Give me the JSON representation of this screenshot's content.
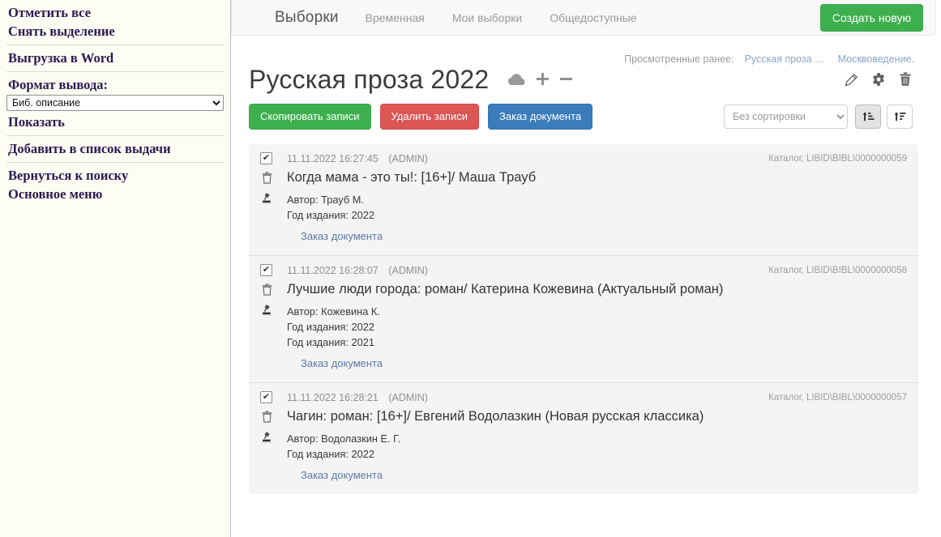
{
  "sidebar": {
    "groups": [
      {
        "items": [
          {
            "label": "Отметить все",
            "name": "select-all-link"
          },
          {
            "label": "Снять выделение",
            "name": "deselect-all-link"
          }
        ]
      },
      {
        "items": [
          {
            "label": "Выгрузка в Word",
            "name": "export-word-link"
          }
        ]
      },
      {
        "items": [
          {
            "label": "Формат вывода:",
            "name": "output-format-label",
            "type": "label"
          },
          {
            "label": "Биб. описание",
            "name": "output-format-select",
            "type": "select",
            "options": [
              "Биб. описание"
            ]
          },
          {
            "label": "Показать",
            "name": "show-link"
          }
        ]
      },
      {
        "items": [
          {
            "label": "Добавить в список выдачи",
            "name": "add-to-issue-list-link"
          }
        ]
      },
      {
        "items": [
          {
            "label": "Вернуться к поиску",
            "name": "back-to-search-link"
          },
          {
            "label": "Основное меню",
            "name": "main-menu-link"
          }
        ]
      }
    ]
  },
  "navbar": {
    "brand": "Выборки",
    "links": [
      {
        "label": "Временная",
        "name": "nav-link-temporary"
      },
      {
        "label": "Мои выборки",
        "name": "nav-link-my-selections"
      },
      {
        "label": "Общедоступные",
        "name": "nav-link-public"
      }
    ],
    "create_button": "Создать новую",
    "create_color": "#3eaf4e"
  },
  "viewed": {
    "label": "Просмотренные ранее:",
    "links": [
      "Русская проза ...",
      "Москвоведение."
    ]
  },
  "header": {
    "title": "Русская проза 2022",
    "title_icons": [
      "cloud-icon",
      "plus-icon",
      "minus-icon"
    ],
    "right_icons": [
      "pencil-icon",
      "gear-icon",
      "trash-icon"
    ]
  },
  "actions": {
    "copy_records": "Скопировать записи",
    "delete_records": "Удалить записи",
    "order_document": "Заказ документа",
    "copy_color": "#3eaf4e",
    "delete_color": "#dc5656",
    "order_color": "#3b7cbd"
  },
  "sort": {
    "selected": "Без сортировки",
    "options": [
      "Без сортировки"
    ],
    "asc_button": "sort-amount-asc-icon",
    "desc_button": "sort-amount-desc-icon"
  },
  "records": [
    {
      "checked": true,
      "timestamp": "11.11.2022 16:27:45",
      "user": "(ADMIN)",
      "catalog": "Каталог, LIBID\\BIBL\\0000000059",
      "title": "Когда мама - это ты!: [16+]/ Маша Трауб",
      "fields": [
        "Автор: Трауб М.",
        "Год издания: 2022"
      ],
      "order_link": "Заказ документа"
    },
    {
      "checked": true,
      "timestamp": "11.11.2022 16:28:07",
      "user": "(ADMIN)",
      "catalog": "Каталог, LIBID\\BIBL\\0000000058",
      "title": "Лучшие люди города: роман/ Катерина Кожевина (Актуальный роман)",
      "fields": [
        "Автор: Кожевина К.",
        "Год издания: 2022",
        "Год издания: 2021"
      ],
      "order_link": "Заказ документа"
    },
    {
      "checked": true,
      "timestamp": "11.11.2022 16:28:21",
      "user": "(ADMIN)",
      "catalog": "Каталог, LIBID\\BIBL\\0000000057",
      "title": "Чагин: роман: [16+]/ Евгений Водолазкин (Новая русская классика)",
      "fields": [
        "Автор: Водолазкин Е. Г.",
        "Год издания: 2022"
      ],
      "order_link": "Заказ документа"
    }
  ]
}
